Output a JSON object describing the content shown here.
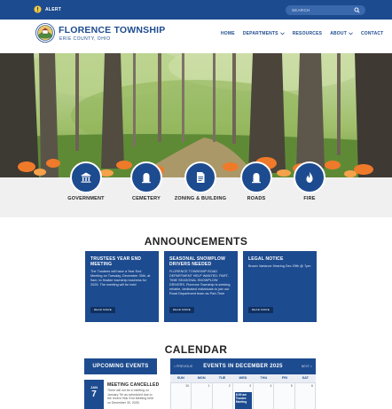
{
  "alert": {
    "label": "ALERT"
  },
  "search": {
    "placeholder": "SEARCH"
  },
  "brand": {
    "title": "FLORENCE TOWNSHIP",
    "subtitle": "ERIE COUNTY, OHIO"
  },
  "nav": {
    "items": [
      {
        "label": "HOME",
        "has_dropdown": false
      },
      {
        "label": "DEPARTMENTS",
        "has_dropdown": true
      },
      {
        "label": "RESOURCES",
        "has_dropdown": false
      },
      {
        "label": "ABOUT",
        "has_dropdown": true
      },
      {
        "label": "CONTACT",
        "has_dropdown": false
      }
    ]
  },
  "quick_links": [
    {
      "label": "GOVERNMENT",
      "icon": "government-building-icon"
    },
    {
      "label": "CEMETERY",
      "icon": "headstone-icon"
    },
    {
      "label": "ZONING & BUILDING",
      "icon": "document-icon"
    },
    {
      "label": "ROADS",
      "icon": "headstone-icon"
    },
    {
      "label": "FIRE",
      "icon": "flame-icon"
    }
  ],
  "announcements": {
    "title": "ANNOUNCEMENTS",
    "cards": [
      {
        "title": "TRUSTEES YEAR END MEETING",
        "body": "The Trustees will have a Year End Meeting on Tuesday, December 30th, at 9am, to finalize township business for 2025. The meeting will be held",
        "button": "READ MORE"
      },
      {
        "title": "SEASONAL SNOWPLOW DRIVERS NEEDED",
        "body": "FLORENCE TOWNSHIP ROAD DEPARTMENT HELP WANTED: PART-TIME SEASONAL SNOWPLOW DRIVERS. Florence Township is seeking reliable, dedicated individuals to join our Road Department team as Part-Time",
        "button": "READ MORE"
      },
      {
        "title": "LEGAL NOTICE",
        "body": "Brown Variance Hearing Dec 29th @ 7pm",
        "button": "READ MORE"
      }
    ]
  },
  "calendar": {
    "title": "CALENDAR",
    "upcoming_label": "UPCOMING EVENTS",
    "upcoming_event": {
      "month": "JAN",
      "day": "7",
      "title": "MEETING CANCELLED",
      "body": "There will not be a meeting on January 7th as scheduled due to the recent Year End Meeting held on December 30, 2025."
    },
    "header": {
      "prev": "< PREVIOUS",
      "month": "EVENTS IN DECEMBER 2025",
      "next": "NEXT >"
    },
    "weekdays": [
      "SUN",
      "MON",
      "TUE",
      "WED",
      "THU",
      "FRI",
      "SAT"
    ],
    "first_week": [
      "30",
      "1",
      "2",
      "3",
      "4",
      "5",
      "6"
    ],
    "event_cell": {
      "time": "8:00 am",
      "title": "Trustee Meeting"
    }
  },
  "colors": {
    "brand_blue": "#1d4b8f",
    "band_gray": "#f0f0f0"
  }
}
